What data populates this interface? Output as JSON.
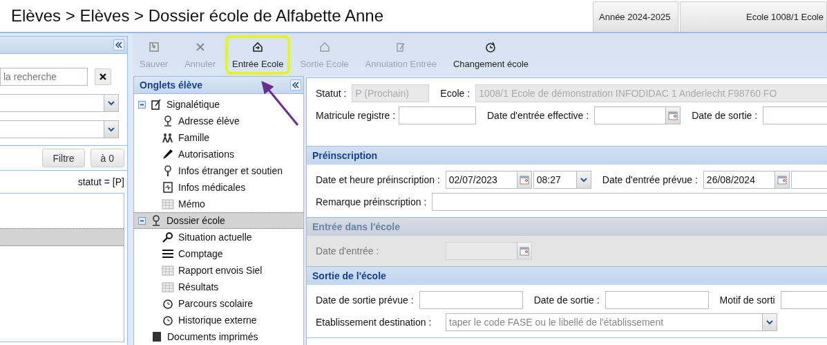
{
  "header": {
    "breadcrumb": "Elèves > Elèves > Dossier école de Alfabette Anne",
    "buttons": [
      "Année 2024-2025",
      "Ecole 1008/1 Ecole"
    ]
  },
  "left_panel": {
    "search": {
      "placeholder": "la recherche"
    },
    "buttons": [
      "Filtre",
      "à 0"
    ],
    "filter_text": "statut = [P]",
    "results": [
      {
        "selected": true
      }
    ]
  },
  "toolbar": [
    {
      "label": "Sauver",
      "disabled": true,
      "highlighted": false
    },
    {
      "label": "Annuler",
      "disabled": true,
      "highlighted": false
    },
    {
      "label": "Entrée Ecole",
      "disabled": false,
      "highlighted": true
    },
    {
      "label": "Sortie Ecole",
      "disabled": true,
      "highlighted": false
    },
    {
      "label": "Annulation Entrée",
      "disabled": true,
      "highlighted": false
    },
    {
      "label": "Changement école",
      "disabled": false,
      "highlighted": false
    }
  ],
  "tree": {
    "title": "Onglets élève",
    "items": [
      {
        "label": "Signalétique",
        "expanded": true,
        "selected": false,
        "children": [
          {
            "label": "Adresse élève",
            "selected": false
          },
          {
            "label": "Famille",
            "selected": false
          },
          {
            "label": "Autorisations",
            "selected": false
          },
          {
            "label": "Infos étranger et soutien",
            "selected": false
          },
          {
            "label": "Infos médicales",
            "selected": false
          },
          {
            "label": "Mémo",
            "selected": false
          }
        ]
      },
      {
        "label": "Dossier école",
        "expanded": true,
        "selected": true,
        "children": [
          {
            "label": "Situation actuelle",
            "selected": false
          },
          {
            "label": "Comptage",
            "selected": false
          },
          {
            "label": "Rapport envois Siel",
            "selected": false
          },
          {
            "label": "Résultats",
            "selected": false
          },
          {
            "label": "Parcours scolaire",
            "selected": false
          },
          {
            "label": "Historique externe",
            "selected": false
          }
        ]
      },
      {
        "label": "Documents imprimés",
        "expanded": false,
        "selected": false
      }
    ]
  },
  "form": [
    {
      "disabled": false,
      "rows": [
        [
          {
            "label": "Statut :",
            "kind": "text",
            "value": "P (Prochain)",
            "disabled": true
          },
          {
            "label": "Ecole :",
            "kind": "wide",
            "value": "1008/1 Ecole de démonstration INFODIDAC 1 Anderlecht F98760 FO",
            "disabled": true
          }
        ],
        [
          {
            "label": "Matricule registre :",
            "kind": "text",
            "disabled": false
          },
          {
            "label": "Date d'entrée effective :",
            "kind": "date",
            "disabled": false
          },
          {
            "label": "Date de sortie :",
            "kind": "text",
            "disabled": false
          }
        ]
      ]
    },
    {
      "title": "Préinscription",
      "disabled": false,
      "rows": [
        [
          {
            "label": "Date et heure préinscription :",
            "kind": "date",
            "value": "02/07/2023",
            "disabled": false
          },
          {
            "kind": "time",
            "value": "08:27",
            "disabled": false
          },
          {
            "label": "Date d'entrée prévue :",
            "kind": "date",
            "value": "26/08/2024",
            "disabled": false
          },
          {
            "kind": "text",
            "disabled": false
          }
        ],
        [
          {
            "label": "Remarque préinscription :",
            "kind": "wide",
            "disabled": false
          }
        ]
      ]
    },
    {
      "title": "Entrée dans l'école",
      "disabled": true,
      "rows": [
        [
          {
            "label": "Date d'entrée :",
            "kind": "date",
            "disabled": true
          }
        ]
      ]
    },
    {
      "title": "Sortie de l'école",
      "disabled": false,
      "rows": [
        [
          {
            "label": "Date de sortie prévue :",
            "kind": "plain",
            "disabled": false
          },
          {
            "label": "Date de sortie :",
            "kind": "plain",
            "disabled": false
          },
          {
            "label": "Motif de sorti",
            "kind": "text",
            "disabled": false
          }
        ],
        [
          {
            "label": "Etablissement destination :",
            "kind": "combo",
            "placeholder": "taper le code FASE ou le libellé de l'établissement",
            "disabled": false
          }
        ]
      ]
    }
  ]
}
